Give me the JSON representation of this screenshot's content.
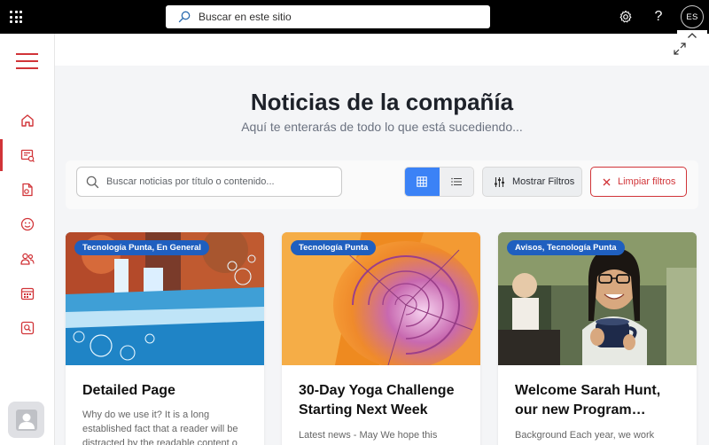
{
  "topbar": {
    "search_placeholder": "Buscar en este sitio",
    "user_initials": "ES",
    "help_label": "?"
  },
  "page": {
    "title": "Noticias de la compañía",
    "subtitle": "Aquí te enterarás de todo lo que está sucediendo..."
  },
  "filters": {
    "search_placeholder": "Buscar noticias por título o contenido...",
    "show_filters_label": "Mostrar Filtros",
    "clear_filters_label": "Limpiar filtros",
    "active_view": "grid"
  },
  "cards": [
    {
      "category": "Tecnología Punta, En General",
      "title": "Detailed Page",
      "excerpt": "Why do we use it? It is a long established fact that a reader will be distracted by the readable content o"
    },
    {
      "category": "Tecnología Punta",
      "title": "30-Day Yoga Challenge Starting Next Week",
      "excerpt": "Latest news - May We hope this"
    },
    {
      "category": "Avisos, Tecnología Punta",
      "title": "Welcome Sarah Hunt, our new Program…",
      "excerpt": "Background Each year, we work"
    }
  ],
  "colors": {
    "accent_red": "#d13438",
    "primary_blue": "#3b82f6",
    "badge_blue": "#1f5fbf"
  },
  "icons": {
    "rail": [
      "home-icon",
      "news-icon",
      "document-icon",
      "smiley-icon",
      "people-icon",
      "calendar-icon",
      "search-document-icon"
    ]
  }
}
